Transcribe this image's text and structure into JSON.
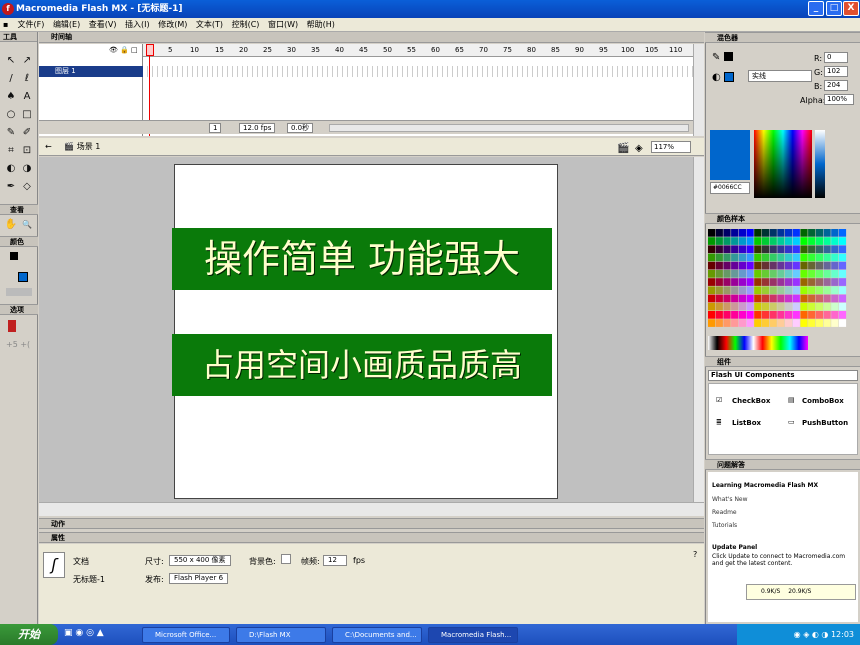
{
  "window": {
    "title": "Macromedia Flash MX - [无标题-1]",
    "minimize": "_",
    "maximize": "□",
    "close": "X"
  },
  "menu": [
    "文件(F)",
    "编辑(E)",
    "查看(V)",
    "插入(I)",
    "修改(M)",
    "文本(T)",
    "控制(C)",
    "窗口(W)",
    "帮助(H)"
  ],
  "tools": {
    "header": "工具",
    "view_label": "查看",
    "colors_label": "颜色",
    "options_label": "选项",
    "icons": [
      "↖",
      "↗",
      "/",
      "ℓ",
      "♠",
      "A",
      "○",
      "□",
      "✎",
      "✐",
      "⌗",
      "⊡",
      "◐",
      "◑",
      "✒",
      "◇",
      "✋",
      "🔍"
    ]
  },
  "timeline": {
    "header": "时间轴",
    "ruler": [
      "1",
      "5",
      "10",
      "15",
      "20",
      "25",
      "30",
      "35",
      "40",
      "45",
      "50",
      "55",
      "60",
      "65",
      "70",
      "75",
      "80",
      "85",
      "90",
      "95",
      "100",
      "105",
      "110"
    ],
    "layer_name": "图层 1",
    "current_frame": "1",
    "fps": "12.0 fps",
    "time": "0.0秒"
  },
  "editbar": {
    "scene": "场景 1",
    "zoom": "117%"
  },
  "stage": {
    "line1": "操作简单 功能强大",
    "line2": "占用空间小画质品质高"
  },
  "actions": {
    "header": "动作"
  },
  "properties": {
    "header": "属性",
    "doc_type": "文档",
    "doc_name": "无标题-1",
    "size_label": "尺寸:",
    "size_value": "550 x 400 像素",
    "bg_label": "背景色:",
    "fps_label": "帧频:",
    "fps_value": "12",
    "fps_unit": "fps",
    "publish_label": "发布:",
    "publish_value": "Flash Player 6"
  },
  "mixer": {
    "header": "混色器",
    "fill_type": "实线",
    "r_label": "R:",
    "r": "0",
    "g_label": "G:",
    "g": "102",
    "b_label": "B:",
    "b": "204",
    "alpha_label": "Alpha:",
    "alpha": "100%",
    "hex": "#0066CC",
    "color": "#0066CC"
  },
  "swatches": {
    "header": "颜色样本"
  },
  "components": {
    "header": "组件",
    "set": "Flash UI Components",
    "items": [
      "CheckBox",
      "ComboBox",
      "ListBox",
      "PushButton"
    ]
  },
  "answers": {
    "header": "问题解答",
    "title": "Learning Macromedia Flash MX",
    "links": [
      "What's New",
      "Readme",
      "Tutorials"
    ],
    "update_title": "Update Panel",
    "update_text": "Click Update to connect to Macromedia.com and get the latest content.",
    "net_down": "0.9K/S",
    "net_up": "20.9K/S"
  },
  "taskbar": {
    "start": "开始",
    "tasks": [
      "Microsoft Office...",
      "D:\\Flash MX",
      "C:\\Documents and...",
      "Macromedia Flash..."
    ],
    "clock": "12:03"
  }
}
